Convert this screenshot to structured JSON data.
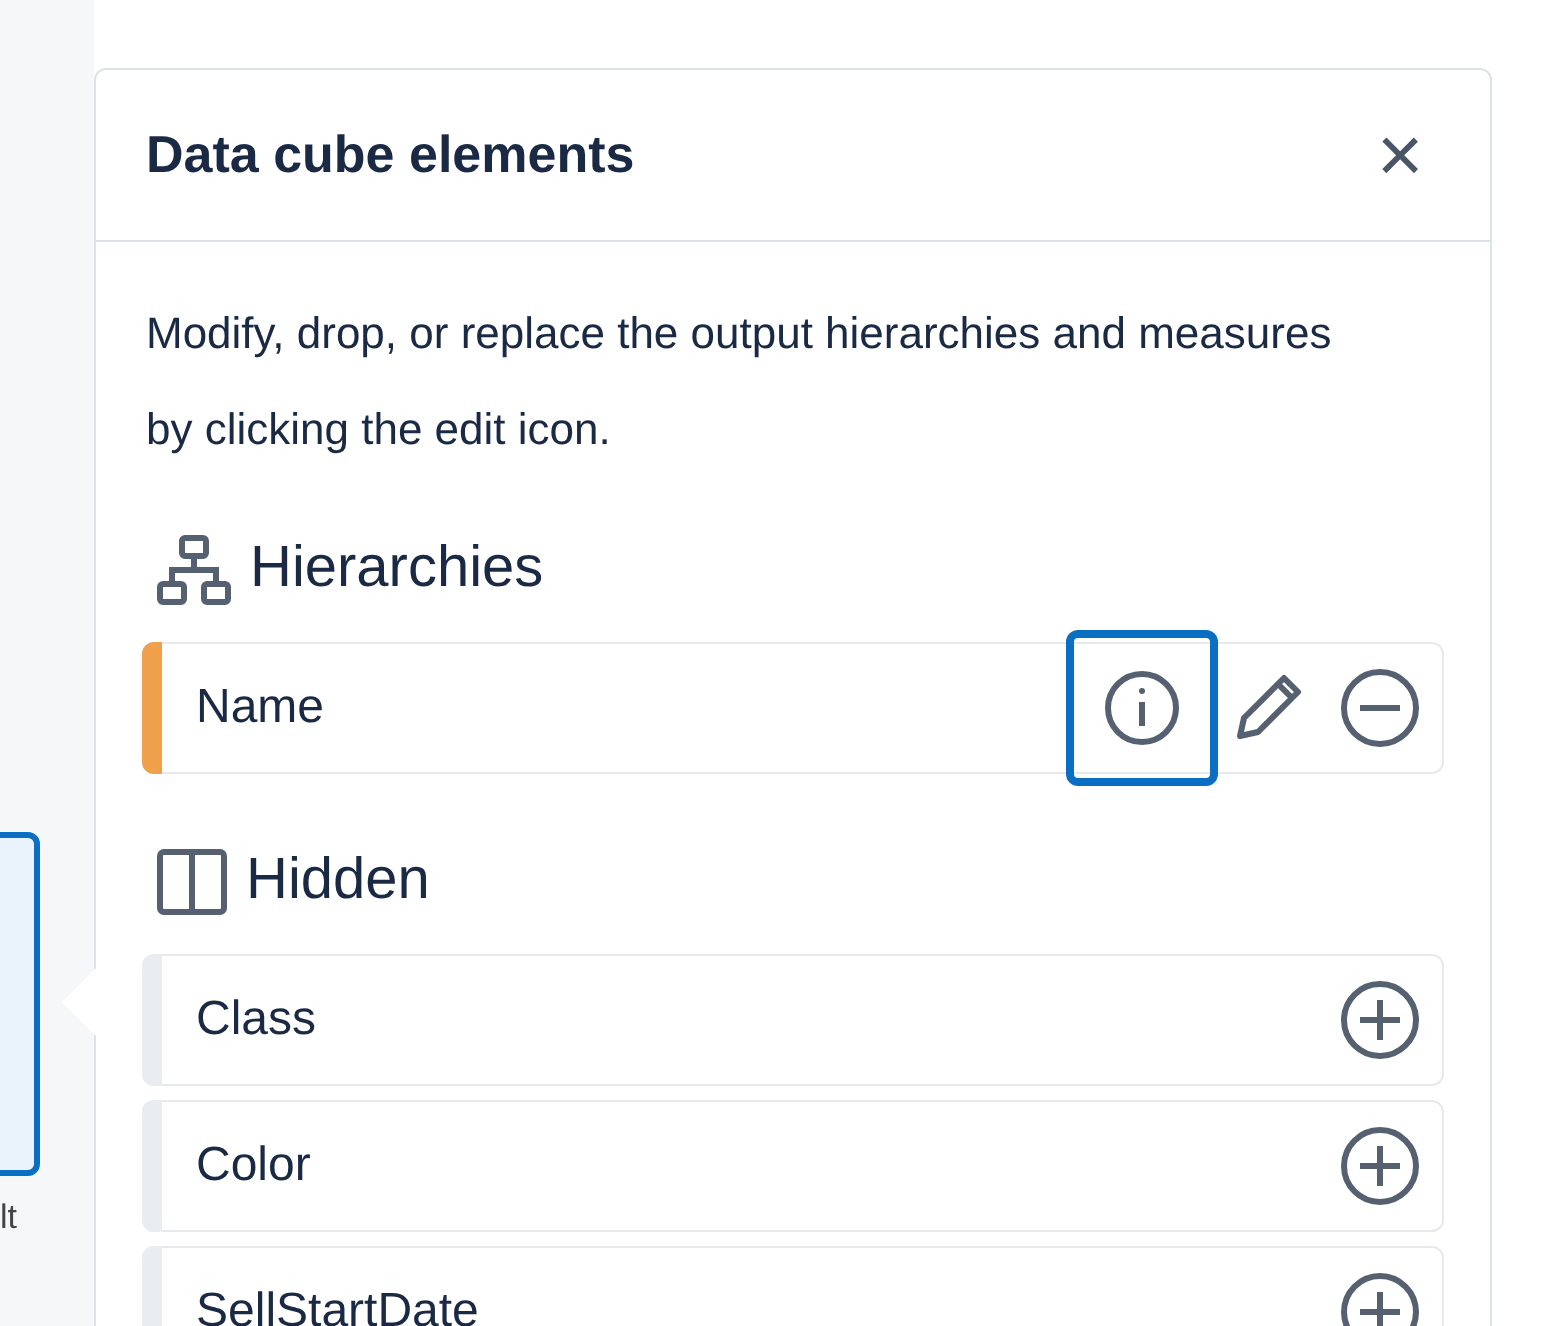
{
  "background_item": {
    "label": "lt",
    "selected": true
  },
  "panel": {
    "title": "Data cube elements",
    "close": "×",
    "description": "Modify, drop, or replace the output hierarchies and measures by clicking the edit icon.",
    "sections": [
      {
        "kind": "hierarchies",
        "heading": "Hierarchies",
        "items": [
          {
            "label": "Name",
            "color": "#f0a04b",
            "kind": "assigned",
            "info_focused": true
          }
        ]
      },
      {
        "kind": "hidden",
        "heading": "Hidden",
        "items": [
          {
            "label": "Class",
            "color": "#e9edf2",
            "kind": "hidden"
          },
          {
            "label": "Color",
            "color": "#e9edf2",
            "kind": "hidden"
          },
          {
            "label": "SellStartDate",
            "color": "#e9edf2",
            "kind": "hidden"
          }
        ]
      }
    ]
  }
}
